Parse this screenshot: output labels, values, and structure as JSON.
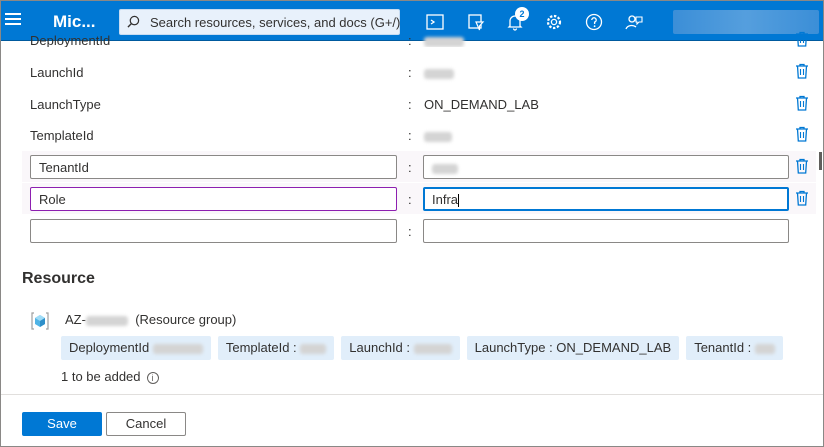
{
  "topbar": {
    "brand": "Mic...",
    "search_placeholder": "Search resources, services, and docs (G+/)",
    "notification_count": "2"
  },
  "tags": [
    {
      "name": "DeploymentId",
      "value": ""
    },
    {
      "name": "LaunchId",
      "value": ""
    },
    {
      "name": "LaunchType",
      "value": "ON_DEMAND_LAB"
    },
    {
      "name": "TemplateId",
      "value": ""
    },
    {
      "name": "TenantId",
      "value": ""
    },
    {
      "name": "Role",
      "value": "Infra"
    },
    {
      "name": "",
      "value": ""
    }
  ],
  "separator": ":",
  "resource": {
    "section_title": "Resource",
    "name_prefix": "AZ-",
    "type_label": "(Resource group)",
    "chips": {
      "deployment": "DeploymentId",
      "template": "TemplateId :",
      "launch": "LaunchId :",
      "launchtype": "LaunchType : ON_DEMAND_LAB",
      "tenant": "TenantId :"
    },
    "added_text": "1 to be added"
  },
  "buttons": {
    "save": "Save",
    "cancel": "Cancel"
  }
}
